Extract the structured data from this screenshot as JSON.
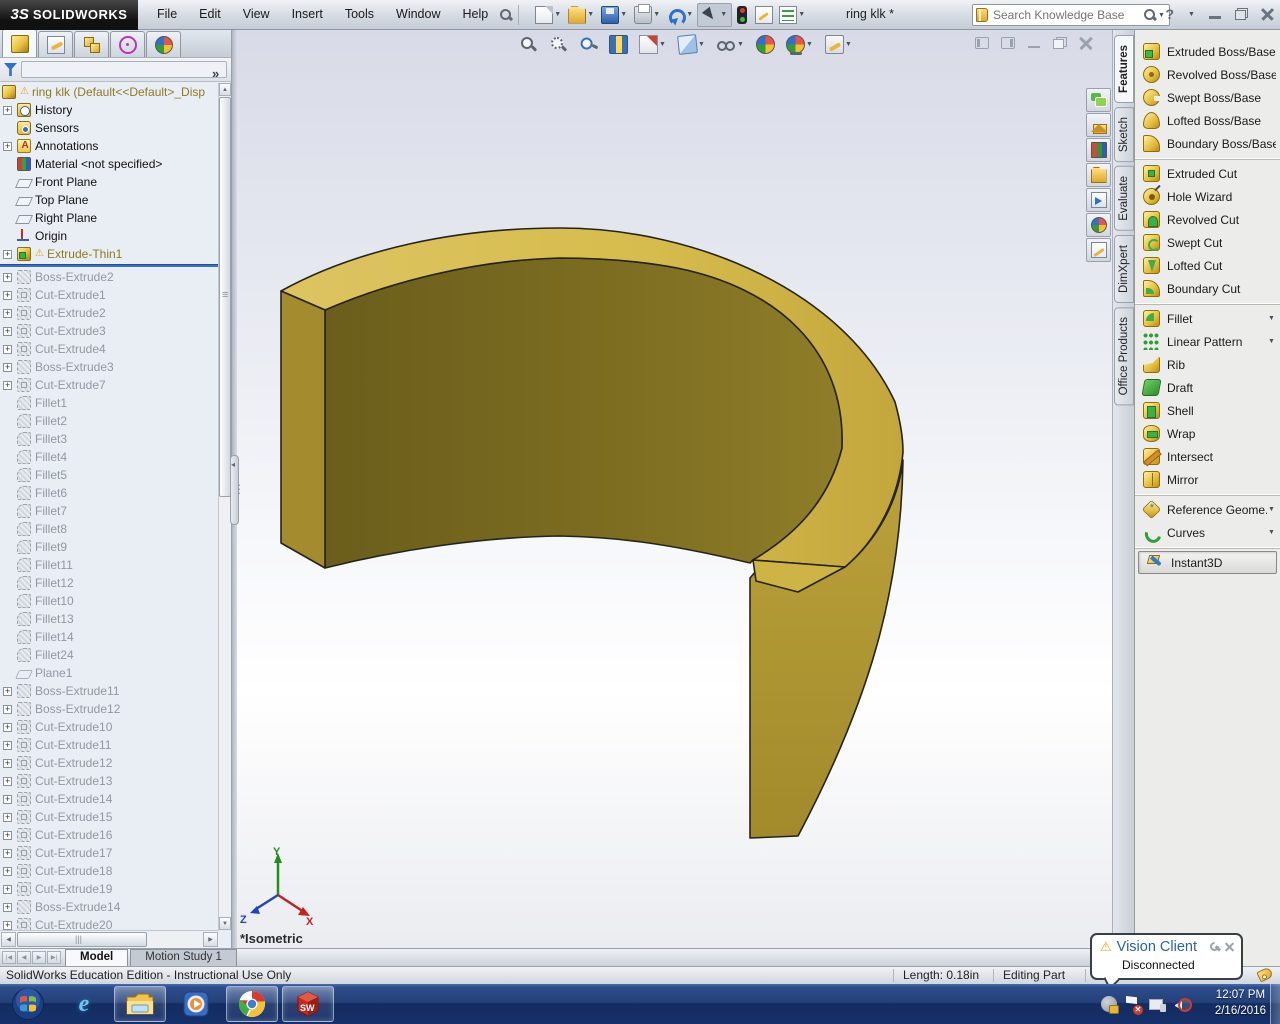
{
  "titlebar": {
    "logo_mark": "3S",
    "logo_text": "SOLIDWORKS",
    "menus": [
      "File",
      "Edit",
      "View",
      "Insert",
      "Tools",
      "Window",
      "Help"
    ],
    "toolbar_icons": [
      {
        "icon": "new-document",
        "dd": true
      },
      {
        "icon": "open",
        "dd": true
      },
      {
        "icon": "save",
        "dd": true
      },
      {
        "icon": "print",
        "dd": true
      },
      {
        "icon": "undo",
        "dd": true
      },
      {
        "icon": "select-arrow",
        "dd": true,
        "cls": "pressed"
      },
      {
        "icon": "rebuild-traffic-light"
      },
      {
        "icon": "file-properties"
      },
      {
        "icon": "options-list",
        "dd": true
      }
    ],
    "doc_title": "ring klk *",
    "search_placeholder": "Search Knowledge Base"
  },
  "feature_manager": {
    "tabs": [
      {
        "icon": "part-tree",
        "cls": "active"
      },
      {
        "icon": "property-manager"
      },
      {
        "icon": "configuration-manager"
      },
      {
        "icon": "dimxpert"
      },
      {
        "icon": "display-manager"
      }
    ],
    "root_label": "ring klk  (Default<<Default>_Disp",
    "items_active": [
      {
        "label": "History",
        "icon": "history",
        "exp": true
      },
      {
        "label": "Sensors",
        "icon": "sensors"
      },
      {
        "label": "Annotations",
        "icon": "annotations",
        "exp": true
      },
      {
        "label": "Material <not specified>",
        "icon": "material"
      },
      {
        "label": "Front Plane",
        "icon": "plane"
      },
      {
        "label": "Top Plane",
        "icon": "plane"
      },
      {
        "label": "Right Plane",
        "icon": "plane"
      },
      {
        "label": "Origin",
        "icon": "origin"
      },
      {
        "label": "Extrude-Thin1",
        "icon": "extrude",
        "exp": true,
        "warn": true,
        "cls": "gold"
      }
    ],
    "items_rolled": [
      {
        "label": "Boss-Extrude2",
        "icon": "boss-gray",
        "exp": true,
        "cls": "gray"
      },
      {
        "label": "Cut-Extrude1",
        "icon": "cut-gray",
        "exp": true,
        "cls": "gray"
      },
      {
        "label": "Cut-Extrude2",
        "icon": "cut-gray",
        "exp": true,
        "cls": "gray"
      },
      {
        "label": "Cut-Extrude3",
        "icon": "cut-gray",
        "exp": true,
        "cls": "gray"
      },
      {
        "label": "Cut-Extrude4",
        "icon": "cut-gray",
        "exp": true,
        "cls": "gray"
      },
      {
        "label": "Boss-Extrude3",
        "icon": "boss-gray",
        "exp": true,
        "cls": "gray"
      },
      {
        "label": "Cut-Extrude7",
        "icon": "cut-gray",
        "exp": true,
        "cls": "gray"
      },
      {
        "label": "Fillet1",
        "icon": "fillet-gray",
        "cls": "gray"
      },
      {
        "label": "Fillet2",
        "icon": "fillet-gray",
        "cls": "gray"
      },
      {
        "label": "Fillet3",
        "icon": "fillet-gray",
        "cls": "gray"
      },
      {
        "label": "Fillet4",
        "icon": "fillet-gray",
        "cls": "gray"
      },
      {
        "label": "Fillet5",
        "icon": "fillet-gray",
        "cls": "gray"
      },
      {
        "label": "Fillet6",
        "icon": "fillet-gray",
        "cls": "gray"
      },
      {
        "label": "Fillet7",
        "icon": "fillet-gray",
        "cls": "gray"
      },
      {
        "label": "Fillet8",
        "icon": "fillet-gray",
        "cls": "gray"
      },
      {
        "label": "Fillet9",
        "icon": "fillet-gray",
        "cls": "gray"
      },
      {
        "label": "Fillet11",
        "icon": "fillet-gray",
        "cls": "gray"
      },
      {
        "label": "Fillet12",
        "icon": "fillet-gray",
        "cls": "gray"
      },
      {
        "label": "Fillet10",
        "icon": "fillet-gray",
        "cls": "gray"
      },
      {
        "label": "Fillet13",
        "icon": "fillet-gray",
        "cls": "gray"
      },
      {
        "label": "Fillet14",
        "icon": "fillet-gray",
        "cls": "gray"
      },
      {
        "label": "Fillet24",
        "icon": "fillet-gray",
        "cls": "gray"
      },
      {
        "label": "Plane1",
        "icon": "plane-gray",
        "cls": "gray"
      },
      {
        "label": "Boss-Extrude11",
        "icon": "boss-gray",
        "exp": true,
        "cls": "gray"
      },
      {
        "label": "Boss-Extrude12",
        "icon": "boss-gray",
        "exp": true,
        "cls": "gray"
      },
      {
        "label": "Cut-Extrude10",
        "icon": "cut-gray",
        "exp": true,
        "cls": "gray"
      },
      {
        "label": "Cut-Extrude11",
        "icon": "cut-gray",
        "exp": true,
        "cls": "gray"
      },
      {
        "label": "Cut-Extrude12",
        "icon": "cut-gray",
        "exp": true,
        "cls": "gray"
      },
      {
        "label": "Cut-Extrude13",
        "icon": "cut-gray",
        "exp": true,
        "cls": "gray"
      },
      {
        "label": "Cut-Extrude14",
        "icon": "cut-gray",
        "exp": true,
        "cls": "gray"
      },
      {
        "label": "Cut-Extrude15",
        "icon": "cut-gray",
        "exp": true,
        "cls": "gray"
      },
      {
        "label": "Cut-Extrude16",
        "icon": "cut-gray",
        "exp": true,
        "cls": "gray"
      },
      {
        "label": "Cut-Extrude17",
        "icon": "cut-gray",
        "exp": true,
        "cls": "gray"
      },
      {
        "label": "Cut-Extrude18",
        "icon": "cut-gray",
        "exp": true,
        "cls": "gray"
      },
      {
        "label": "Cut-Extrude19",
        "icon": "cut-gray",
        "exp": true,
        "cls": "gray"
      },
      {
        "label": "Boss-Extrude14",
        "icon": "boss-gray",
        "exp": true,
        "cls": "gray"
      },
      {
        "label": "Cut-Extrude20",
        "icon": "cut-gray",
        "exp": true,
        "cls": "gray"
      }
    ]
  },
  "headsup_icons": [
    {
      "icon": "zoom-fit"
    },
    {
      "icon": "zoom-area"
    },
    {
      "icon": "zoom-selection"
    },
    {
      "icon": "section-view"
    },
    {
      "icon": "view-orientation",
      "dd": true
    },
    {
      "icon": "display-style",
      "dd": true
    },
    {
      "icon": "hide-show-items",
      "dd": true
    },
    {
      "icon": "apply-scene"
    },
    {
      "icon": "view-settings",
      "dd": true
    },
    {
      "icon": "edit-appearance",
      "dd": true
    }
  ],
  "viewport": {
    "orientation_label": "*Isometric",
    "triad": {
      "x": "X",
      "y": "Y",
      "z": "Z"
    }
  },
  "taskpane_icons": [
    {
      "icon": "forum"
    },
    {
      "icon": "resources-home"
    },
    {
      "icon": "design-library"
    },
    {
      "icon": "file-explorer"
    },
    {
      "icon": "view-palette"
    },
    {
      "icon": "appearances"
    },
    {
      "icon": "custom-properties"
    }
  ],
  "command_manager": {
    "tabs": [
      {
        "label": "Features",
        "cls": "active"
      },
      {
        "label": "Sketch"
      },
      {
        "label": "Evaluate"
      },
      {
        "label": "DimXpert"
      },
      {
        "label": "Office Products"
      }
    ],
    "groups": [
      {
        "items": [
          {
            "label": "Extruded Boss/Base",
            "icon": "extruded-boss"
          },
          {
            "label": "Revolved Boss/Base",
            "icon": "revolved-boss"
          },
          {
            "label": "Swept Boss/Base",
            "icon": "swept-boss"
          },
          {
            "label": "Lofted Boss/Base",
            "icon": "lofted-boss"
          },
          {
            "label": "Boundary Boss/Base",
            "icon": "boundary-boss"
          }
        ]
      },
      {
        "items": [
          {
            "label": "Extruded Cut",
            "icon": "extruded-cut"
          },
          {
            "label": "Hole Wizard",
            "icon": "hole-wizard"
          },
          {
            "label": "Revolved Cut",
            "icon": "revolved-cut"
          },
          {
            "label": "Swept Cut",
            "icon": "swept-cut"
          },
          {
            "label": "Lofted Cut",
            "icon": "lofted-cut"
          },
          {
            "label": "Boundary Cut",
            "icon": "boundary-cut"
          }
        ]
      },
      {
        "items": [
          {
            "label": "Fillet",
            "icon": "fillet",
            "dd": true
          },
          {
            "label": "Linear Pattern",
            "icon": "linear-pattern",
            "dd": true
          },
          {
            "label": "Rib",
            "icon": "rib"
          },
          {
            "label": "Draft",
            "icon": "draft"
          },
          {
            "label": "Shell",
            "icon": "shell"
          },
          {
            "label": "Wrap",
            "icon": "wrap"
          },
          {
            "label": "Intersect",
            "icon": "intersect"
          },
          {
            "label": "Mirror",
            "icon": "mirror"
          }
        ]
      },
      {
        "items": [
          {
            "label": "Reference Geome...",
            "icon": "reference-geometry",
            "dd": true
          },
          {
            "label": "Curves",
            "icon": "curves",
            "dd": true
          }
        ]
      },
      {
        "items": [
          {
            "label": "Instant3D",
            "icon": "instant3d",
            "cls": "pressed"
          }
        ]
      }
    ]
  },
  "bottom_tabs": {
    "model": "Model",
    "motion": "Motion Study 1"
  },
  "statusbar": {
    "edition": "SolidWorks Education Edition - Instructional Use Only",
    "length": "Length: 0.18in",
    "mode": "Editing Part"
  },
  "vision_popup": {
    "title": "Vision Client",
    "status": "Disconnected"
  },
  "taskbar": {
    "apps": [
      "start",
      "internet-explorer",
      "windows-explorer",
      "windows-media-player",
      "chrome",
      "solidworks"
    ],
    "ie_letter": "e",
    "sw_letters": "SW",
    "clock_time": "12:07 PM",
    "clock_date": "2/16/2016"
  },
  "model_colors": {
    "top_face": "#d9c050",
    "inner_wall_dark": "#6b5e1c",
    "inner_wall_light": "#8f7d28",
    "outer_wall": "#b29a35",
    "edge": "#26241a",
    "rollback_blue": "#3a6fc4",
    "popup_title_blue": "#2a62b5"
  }
}
